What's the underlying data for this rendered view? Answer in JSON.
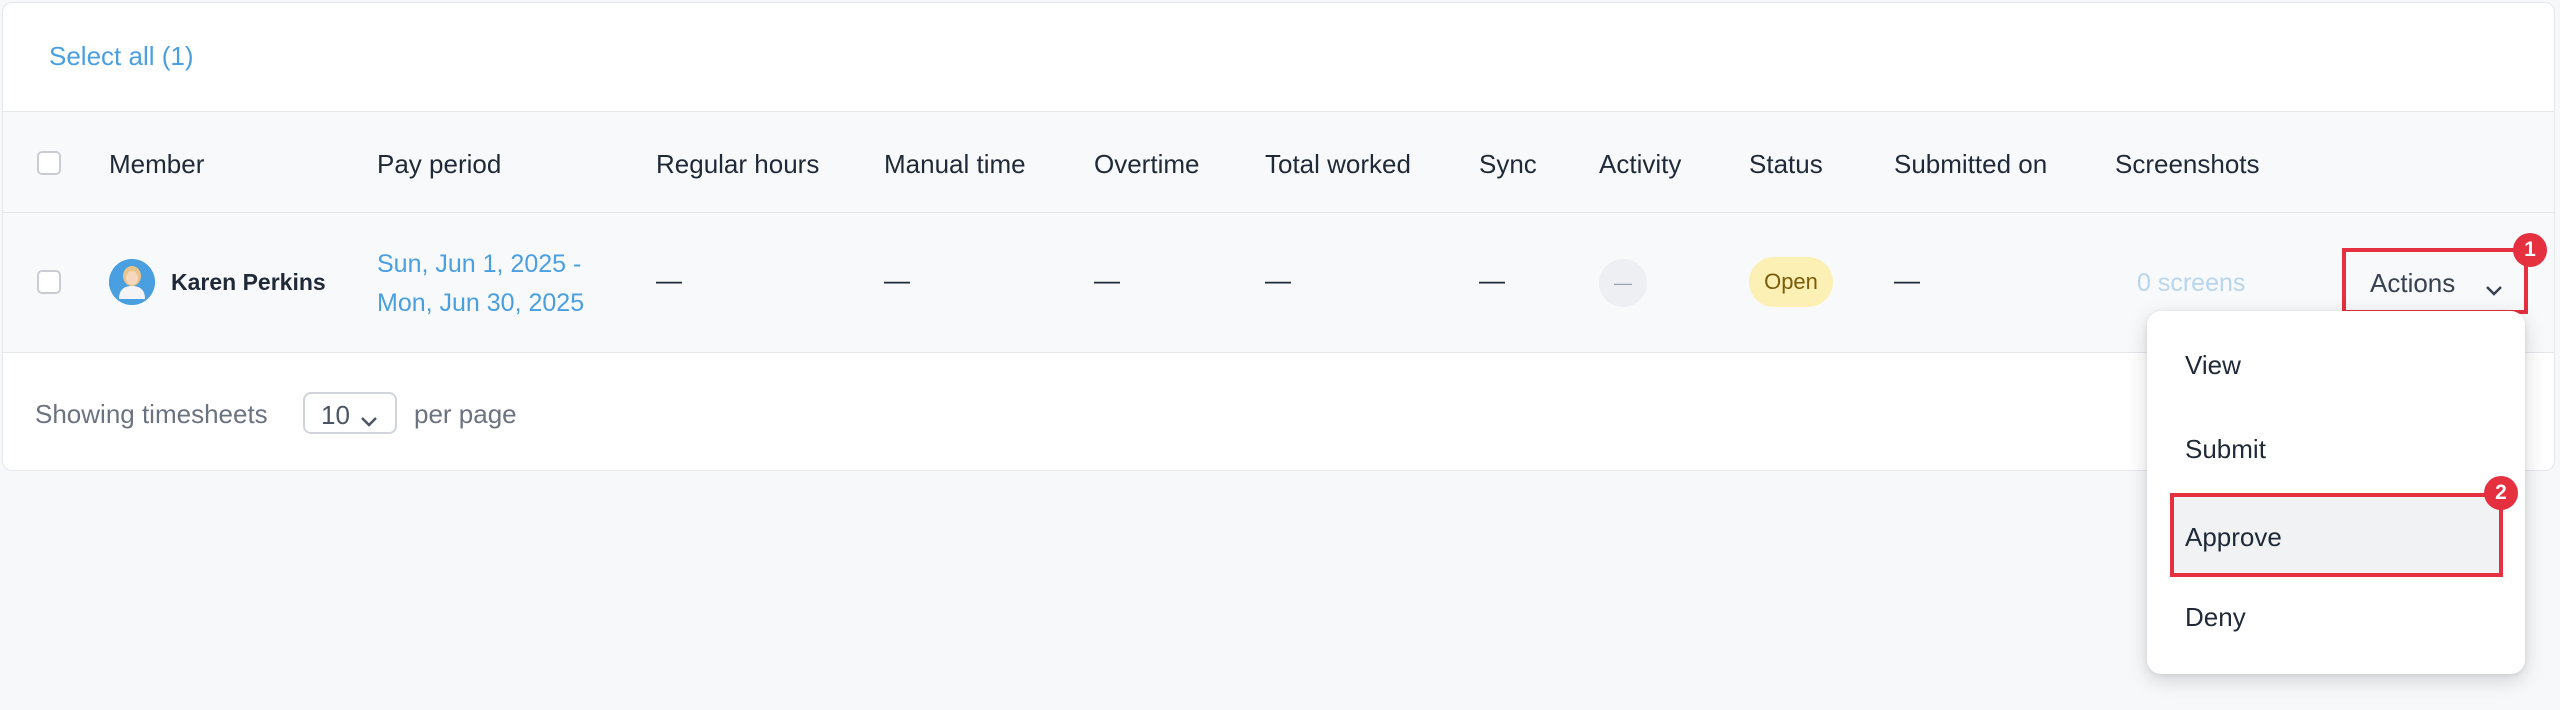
{
  "toolbar": {
    "select_all_label": "Select all (1)"
  },
  "table": {
    "headers": [
      "Member",
      "Pay period",
      "Regular hours",
      "Manual time",
      "Overtime",
      "Total worked",
      "Sync",
      "Activity",
      "Status",
      "Submitted on",
      "Screenshots"
    ],
    "rows": [
      {
        "member": "Karen Perkins",
        "pay_period_line1": "Sun, Jun 1, 2025 -",
        "pay_period_line2": "Mon, Jun 30, 2025",
        "regular_hours": "—",
        "manual_time": "—",
        "overtime": "—",
        "total_worked": "—",
        "sync": "—",
        "activity": "—",
        "status": "Open",
        "submitted_on": "—",
        "screenshots": "0 screens",
        "actions_label": "Actions"
      }
    ]
  },
  "footer": {
    "showing_label": "Showing timesheets",
    "page_size": "10",
    "per_page_label": "per page"
  },
  "actions_menu": {
    "items": [
      "View",
      "Submit",
      "Approve",
      "Deny"
    ]
  },
  "annotations": {
    "badge_1": "1",
    "badge_2": "2"
  },
  "colors": {
    "accent": "#4a9fe0",
    "highlight_border": "#e4303f",
    "status_open_bg": "#fdf0b4",
    "status_open_text": "#7a5b08"
  },
  "icons": {
    "avatar": "avatar",
    "actions_chevron": "chevron-down-icon",
    "page_size_chevron": "chevron-down-icon"
  }
}
